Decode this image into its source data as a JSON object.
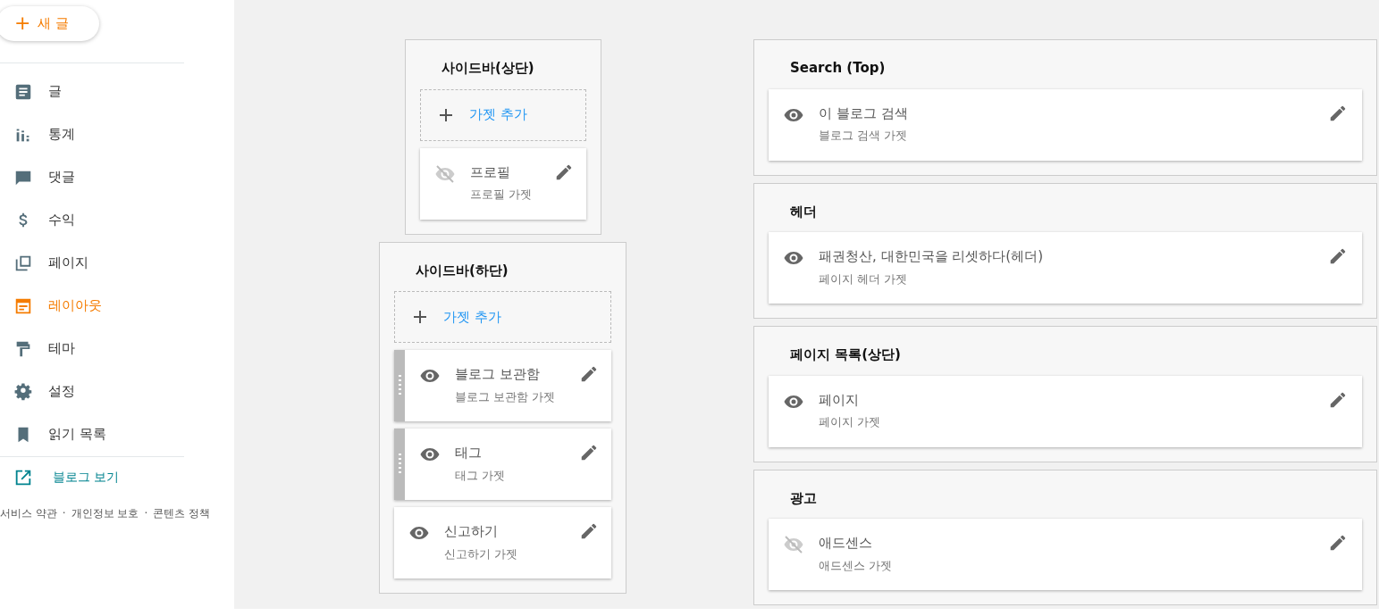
{
  "new_post_button": {
    "icon": "+",
    "label": "새 글"
  },
  "nav": [
    {
      "label": "글",
      "selected": false
    },
    {
      "label": "통계",
      "selected": false
    },
    {
      "label": "댓글",
      "selected": false
    },
    {
      "label": "수익",
      "selected": false
    },
    {
      "label": "페이지",
      "selected": false
    },
    {
      "label": "레이아웃",
      "selected": true
    },
    {
      "label": "테마",
      "selected": false
    },
    {
      "label": "설정",
      "selected": false
    },
    {
      "label": "읽기 목록",
      "selected": false
    }
  ],
  "view_blog_link": "블로그 보기",
  "footer_links": [
    "서비스 약관",
    "개인정보 보호",
    "콘텐츠 정책"
  ],
  "footer_separator": "·",
  "left_sections": [
    {
      "title": "사이드바(상단)",
      "add_label": "가젯 추가",
      "gadgets": [
        {
          "name": "프로필",
          "type": "프로필 가젯",
          "visible": false,
          "draggable": false
        }
      ]
    },
    {
      "title": "사이드바(하단)",
      "add_label": "가젯 추가",
      "gadgets": [
        {
          "name": "블로그 보관함",
          "type": "블로그 보관함 가젯",
          "visible": true,
          "draggable": true
        },
        {
          "name": "태그",
          "type": "태그 가젯",
          "visible": true,
          "draggable": true
        },
        {
          "name": "신고하기",
          "type": "신고하기 가젯",
          "visible": true,
          "draggable": false
        }
      ]
    }
  ],
  "right_sections": [
    {
      "title": "Search (Top)",
      "gadgets": [
        {
          "name": "이 블로그 검색",
          "type": "블로그 검색 가젯",
          "visible": true,
          "draggable": false
        }
      ]
    },
    {
      "title": "헤더",
      "gadgets": [
        {
          "name": "패권청산, 대한민국을 리셋하다(헤더)",
          "type": "페이지 헤더 가젯",
          "visible": true,
          "draggable": false
        }
      ]
    },
    {
      "title": "페이지 목록(상단)",
      "gadgets": [
        {
          "name": "페이지",
          "type": "페이지 가젯",
          "visible": true,
          "draggable": false
        }
      ]
    },
    {
      "title": "광고",
      "gadgets": [
        {
          "name": "애드센스",
          "type": "애드센스 가젯",
          "visible": false,
          "draggable": false
        }
      ]
    }
  ]
}
